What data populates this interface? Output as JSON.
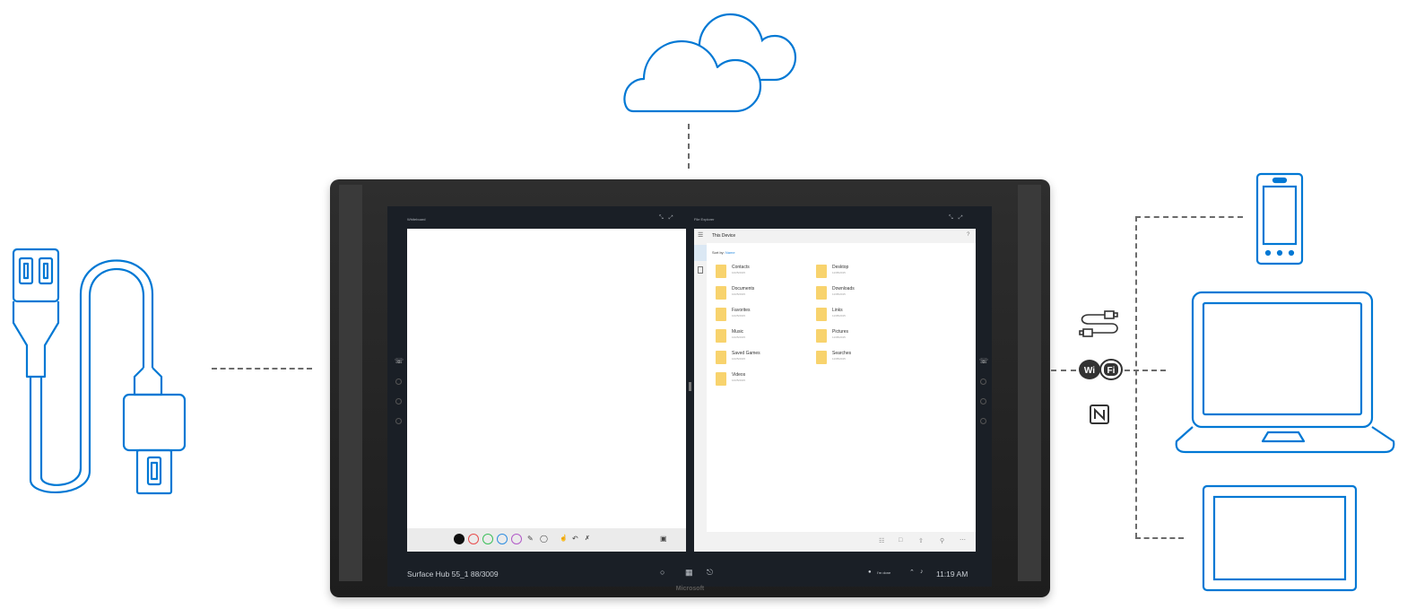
{
  "hub": {
    "brand": "Microsoft",
    "whiteboard": {
      "title": "Whiteboard",
      "pen_colors": [
        "#111111",
        "#e84c4c",
        "#3cbf5a",
        "#2e8de0",
        "#b25ac8"
      ]
    },
    "file_explorer": {
      "title": "File Explorer",
      "location": "This Device",
      "sort_label": "Sort by:",
      "sort_value": "Name",
      "folders_col1": [
        {
          "name": "Contacts",
          "date": "10/25/2015"
        },
        {
          "name": "Documents",
          "date": "10/25/2015"
        },
        {
          "name": "Favorites",
          "date": "10/25/2015"
        },
        {
          "name": "Music",
          "date": "10/25/2015"
        },
        {
          "name": "Saved Games",
          "date": "10/25/2015"
        },
        {
          "name": "Videos",
          "date": "10/25/2015"
        }
      ],
      "folders_col2": [
        {
          "name": "Desktop",
          "date": "11/05/2015"
        },
        {
          "name": "Downloads",
          "date": "11/05/2015"
        },
        {
          "name": "Links",
          "date": "11/05/2015"
        },
        {
          "name": "Pictures",
          "date": "11/05/2015"
        },
        {
          "name": "Searches",
          "date": "11/05/2015"
        }
      ]
    },
    "taskbar": {
      "device_name": "Surface Hub 55_1 88/3009",
      "clock": "11:19 AM",
      "status": "I'm done"
    }
  },
  "colors": {
    "icon_blue": "#0078d4",
    "connector_gray": "#6b6b6b",
    "device_frame": "#262626"
  },
  "icons": [
    "cloud-icon",
    "usb-cable-icon",
    "phone-icon",
    "laptop-icon",
    "tablet-icon",
    "usb-small-icon",
    "wifi-icon",
    "nfc-icon"
  ]
}
